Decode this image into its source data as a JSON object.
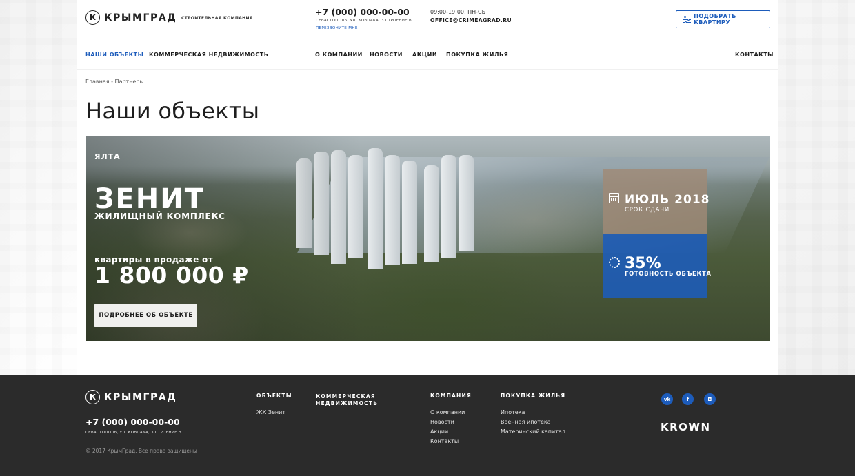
{
  "header": {
    "logo_mark": "К",
    "logo_text": "КРЫМГРАД",
    "tagline": "СТРОИТЕЛЬНАЯ КОМПАНИЯ",
    "phone": "+7 (000) 000-00-00",
    "address": "СЕВАСТОПОЛЬ, УЛ. КОВПАКА, 3 СТРОЕНИЕ В",
    "callback": "ПЕРЕЗВОНИТЕ МНЕ",
    "hours": "09:00-19:00, ПН-СБ",
    "email": "OFFICE@CRIMEAGRAD.RU",
    "pick_button": "ПОДОБРАТЬ КВАРТИРУ"
  },
  "nav": {
    "objects": "НАШИ ОБЪЕКТЫ",
    "commercial": "КОММЕРЧЕСКАЯ НЕДВИЖИМОСТЬ",
    "about": "О КОМПАНИИ",
    "news": "НОВОСТИ",
    "promos": "АКЦИИ",
    "buying": "ПОКУПКА ЖИЛЬЯ",
    "contacts": "КОНТАКТЫ"
  },
  "breadcrumb": {
    "home": "Главная",
    "separator": " - ",
    "current": "Партнеры"
  },
  "page_title": "Наши объекты",
  "hero": {
    "city": "ЯЛТА",
    "name": "ЗЕНИТ",
    "type": "ЖИЛИЩНЫЙ КОМПЛЕКС",
    "price_from": "квартиры в продаже от",
    "price": "1 800 000 ₽",
    "more_button": "ПОДРОБНЕЕ ОБ ОБЪЕКТЕ",
    "date_value": "ИЮЛЬ 2018",
    "date_label": "СРОК СДАЧИ",
    "ready_value": "35%",
    "ready_label": "ГОТОВНОСТЬ ОБЪЕКТА",
    "colors": {
      "date_box": "#a08a76",
      "ready_box": "#1d5cbb"
    }
  },
  "footer": {
    "logo_text": "КРЫМГРАД",
    "phone": "+7 (000) 000-00-00",
    "address": "СЕВАСТОПОЛЬ, УЛ. КОВПАКА, 3 СТРОЕНИЕ В",
    "copyright": "© 2017 КрымГрад. Все права защищены",
    "col_objects": {
      "head": "ОБЪЕКТЫ",
      "links": [
        "ЖК Зенит"
      ]
    },
    "col_commercial": {
      "head_line1": "КОММЕРЧЕСКАЯ",
      "head_line2": "НЕДВИЖИМОСТЬ"
    },
    "col_company": {
      "head": "КОМПАНИЯ",
      "links": [
        "О компании",
        "Новости",
        "Акции",
        "Контакты"
      ]
    },
    "col_buying": {
      "head": "ПОКУПКА ЖИЛЬЯ",
      "links": [
        "Ипотека",
        "Военная ипотека",
        "Материнский капитал"
      ]
    },
    "social": {
      "vk": "vk",
      "fb": "f",
      "ig": "◘"
    },
    "developer": "KROWN"
  },
  "accent_color": "#1d5cbb"
}
